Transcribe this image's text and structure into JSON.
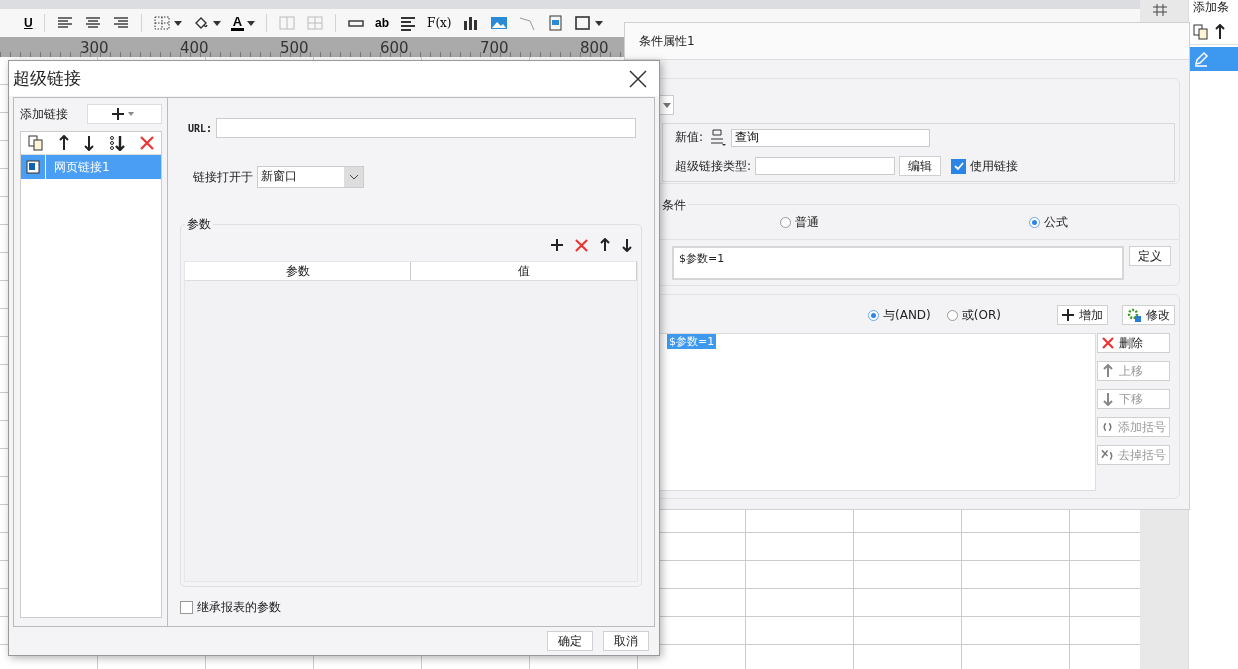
{
  "toolbar": [
    {
      "kind": "underline",
      "label": "U"
    },
    {
      "kind": "sep"
    },
    {
      "kind": "align-left"
    },
    {
      "kind": "align-center"
    },
    {
      "kind": "align-right"
    },
    {
      "kind": "sep"
    },
    {
      "kind": "borders",
      "dropdown": true
    },
    {
      "kind": "fill",
      "dropdown": true
    },
    {
      "kind": "font-color",
      "label": "A",
      "dropdown": true
    },
    {
      "kind": "sep"
    },
    {
      "kind": "merge"
    },
    {
      "kind": "table"
    },
    {
      "kind": "sep"
    },
    {
      "kind": "field"
    },
    {
      "kind": "text",
      "label": "ab"
    },
    {
      "kind": "lines"
    },
    {
      "kind": "formula",
      "label": "F(x)"
    },
    {
      "kind": "chart"
    },
    {
      "kind": "image"
    },
    {
      "kind": "slash"
    },
    {
      "kind": "page"
    },
    {
      "kind": "frame",
      "dropdown": true
    }
  ],
  "ruler": [
    "300",
    "400",
    "500",
    "600",
    "700",
    "800"
  ],
  "side_panel": {
    "title": "添加条"
  },
  "condition_window": {
    "title": "条件属性1",
    "new_value": {
      "label": "新值:",
      "value": "查询"
    },
    "link_type": {
      "label": "超级链接类型:",
      "edit_button": "编辑"
    },
    "use_link": {
      "label": "使用链接",
      "checked": true
    },
    "condition_legend": "条件",
    "condition_type": [
      {
        "label": "普通",
        "selected": false
      },
      {
        "label": "公式",
        "selected": true
      }
    ],
    "formula": "$参数=1",
    "define_button": "定义",
    "joiners": [
      {
        "label": "与(AND)",
        "selected": true
      },
      {
        "label": "或(OR)",
        "selected": false
      }
    ],
    "add_button": "增加",
    "modify_button": "修改",
    "conditions": [
      {
        "text": "$参数=1",
        "selected": true
      }
    ],
    "side_buttons": [
      {
        "kind": "delete",
        "label": "删除",
        "disabled": false
      },
      {
        "kind": "up",
        "label": "上移",
        "disabled": true
      },
      {
        "kind": "down",
        "label": "下移",
        "disabled": true
      },
      {
        "kind": "add-paren",
        "label": "添加括号",
        "disabled": true
      },
      {
        "kind": "remove-paren",
        "label": "去掉括号",
        "disabled": true
      }
    ]
  },
  "hyperlink_dialog": {
    "title": "超级链接",
    "add_label": "添加链接",
    "links": [
      {
        "name": "网页链接1",
        "selected": true
      }
    ],
    "url": {
      "label": "URL:"
    },
    "open_in": {
      "label": "链接打开于",
      "value": "新窗口"
    },
    "params": {
      "legend": "参数",
      "columns": [
        "参数",
        "值"
      ]
    },
    "inherit": {
      "label": "继承报表的参数",
      "checked": false
    },
    "ok": "确定",
    "cancel": "取消"
  }
}
